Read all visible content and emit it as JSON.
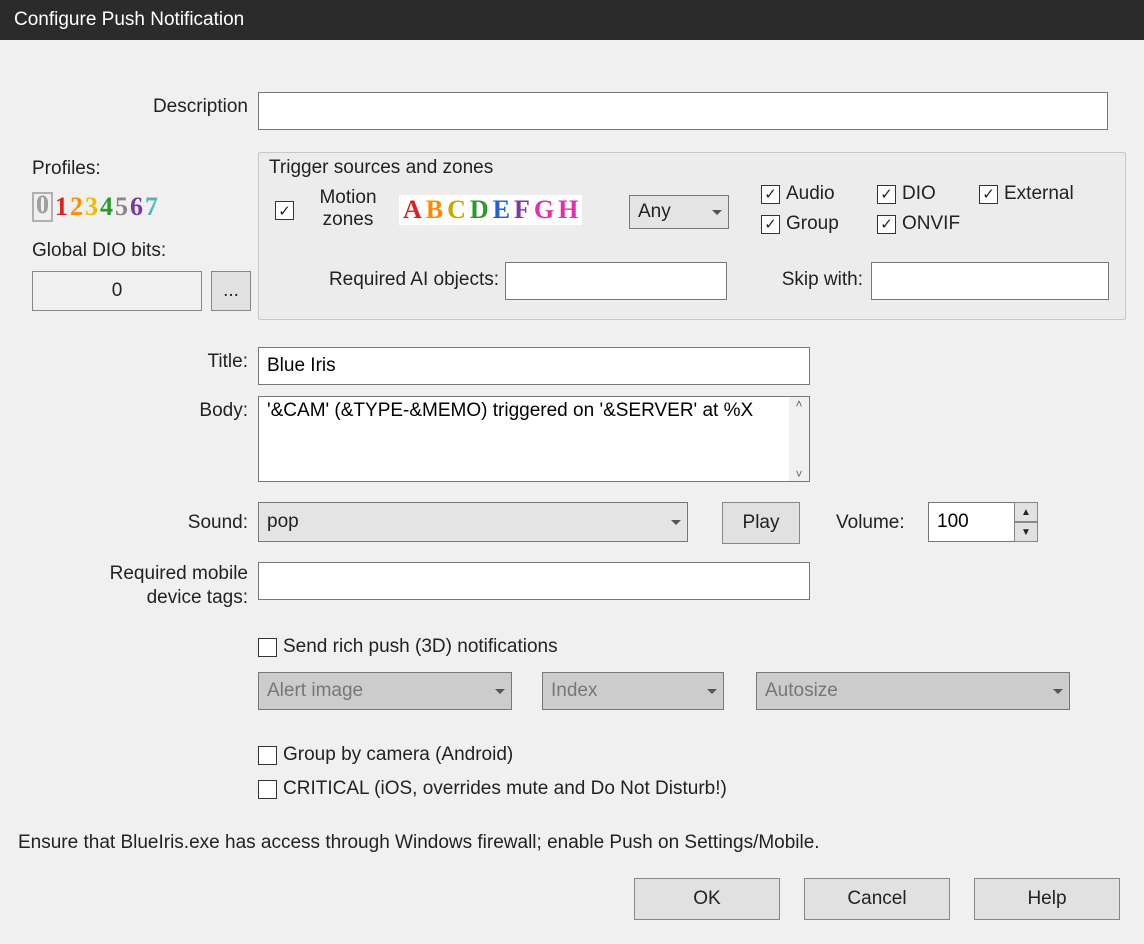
{
  "window": {
    "title": "Configure Push Notification"
  },
  "labels": {
    "description": "Description",
    "profiles": "Profiles:",
    "global_dio": "Global DIO bits:",
    "title": "Title:",
    "body": "Body:",
    "sound": "Sound:",
    "volume": "Volume:",
    "required_tags_l1": "Required mobile",
    "required_tags_l2": "device tags:",
    "trigger_legend": "Trigger sources and zones",
    "motion_l1": "Motion",
    "motion_l2": "zones",
    "required_ai": "Required AI objects:",
    "skip_with": "Skip with:"
  },
  "profiles": [
    "0",
    "1",
    "2",
    "3",
    "4",
    "5",
    "6",
    "7"
  ],
  "dio": {
    "value": "0",
    "browse": "..."
  },
  "zones": [
    "A",
    "B",
    "C",
    "D",
    "E",
    "F",
    "G",
    "H"
  ],
  "any_select": "Any",
  "trigger_checks": {
    "motion": true,
    "audio": {
      "label": "Audio",
      "checked": true
    },
    "group": {
      "label": "Group",
      "checked": true
    },
    "dio": {
      "label": "DIO",
      "checked": true
    },
    "onvif": {
      "label": "ONVIF",
      "checked": true
    },
    "external": {
      "label": "External",
      "checked": true
    }
  },
  "required_ai_value": "",
  "skip_with_value": "",
  "title_value": "Blue Iris",
  "body_value": "'&CAM' (&TYPE-&MEMO) triggered on '&SERVER' at %X",
  "sound_value": "pop",
  "play_label": "Play",
  "volume_value": "100",
  "tags_value": "",
  "rich_push": {
    "label": "Send rich push (3D) notifications",
    "checked": false
  },
  "rich_selects": {
    "s1": "Alert image",
    "s2": "Index",
    "s3": "Autosize"
  },
  "group_by_camera": {
    "label": "Group by camera (Android)",
    "checked": false
  },
  "critical": {
    "label": "CRITICAL (iOS, overrides mute and Do Not Disturb!)",
    "checked": false
  },
  "footer_note": "Ensure that BlueIris.exe has access through Windows firewall; enable Push on Settings/Mobile.",
  "buttons": {
    "ok": "OK",
    "cancel": "Cancel",
    "help": "Help"
  }
}
